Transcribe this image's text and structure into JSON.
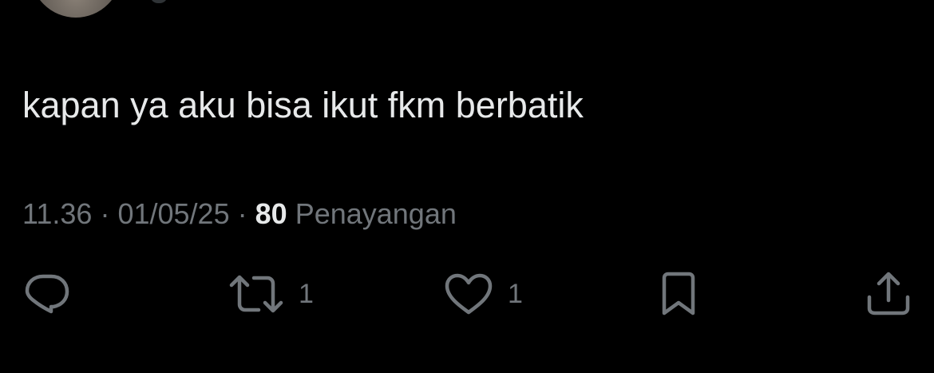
{
  "tweet": {
    "text": "kapan ya aku bisa ikut fkm berbatik",
    "time": "11.36",
    "separator": "·",
    "date": "01/05/25",
    "views_count": "80",
    "views_label": "Penayangan"
  },
  "actions": {
    "reply_icon": "reply-icon",
    "retweet_icon": "retweet-icon",
    "retweet_count": "1",
    "like_icon": "heart-icon",
    "like_count": "1",
    "bookmark_icon": "bookmark-icon",
    "share_icon": "share-icon"
  },
  "colors": {
    "background": "#000000",
    "text_primary": "#e7e9ea",
    "text_secondary": "#71767b"
  }
}
